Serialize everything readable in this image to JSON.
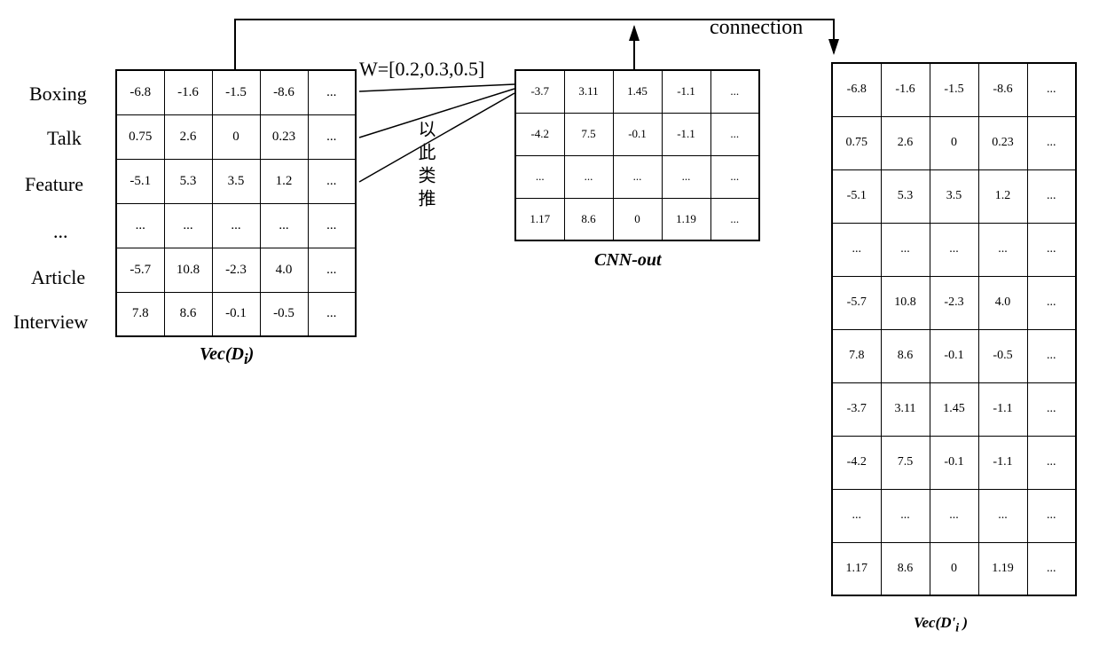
{
  "labels": {
    "row0": "Boxing",
    "row1": "Talk",
    "row2": "Feature",
    "row3": "...",
    "row4": "Article",
    "row5": "Interview",
    "connection": "connection",
    "weights": "W=[0.2,0.3,0.5]",
    "ycltp": "以此类推"
  },
  "captions": {
    "vecDi": "Vec(D_i)",
    "cnnOut": "CNN-out",
    "vecDiPrime": "Vec(D'_i )"
  },
  "chart_data": {
    "type": "table",
    "tables": [
      {
        "name": "Vec(D_i)",
        "row_labels": [
          "Boxing",
          "Talk",
          "Feature",
          "...",
          "Article",
          "Interview"
        ],
        "cells": [
          [
            "-6.8",
            "-1.6",
            "-1.5",
            "-8.6",
            "..."
          ],
          [
            "0.75",
            "2.6",
            "0",
            "0.23",
            "..."
          ],
          [
            "-5.1",
            "5.3",
            "3.5",
            "1.2",
            "..."
          ],
          [
            "...",
            "...",
            "...",
            "...",
            "..."
          ],
          [
            "-5.7",
            "10.8",
            "-2.3",
            "4.0",
            "..."
          ],
          [
            "7.8",
            "8.6",
            "-0.1",
            "-0.5",
            "..."
          ]
        ]
      },
      {
        "name": "CNN-out",
        "cells": [
          [
            "-3.7",
            "3.11",
            "1.45",
            "-1.1",
            "..."
          ],
          [
            "-4.2",
            "7.5",
            "-0.1",
            "-1.1",
            "..."
          ],
          [
            "...",
            "...",
            "...",
            "...",
            "..."
          ],
          [
            "1.17",
            "8.6",
            "0",
            "1.19",
            "..."
          ]
        ]
      },
      {
        "name": "Vec(D'_i)",
        "cells": [
          [
            "-6.8",
            "-1.6",
            "-1.5",
            "-8.6",
            "..."
          ],
          [
            "0.75",
            "2.6",
            "0",
            "0.23",
            "..."
          ],
          [
            "-5.1",
            "5.3",
            "3.5",
            "1.2",
            "..."
          ],
          [
            "...",
            "...",
            "...",
            "...",
            "..."
          ],
          [
            "-5.7",
            "10.8",
            "-2.3",
            "4.0",
            "..."
          ],
          [
            "7.8",
            "8.6",
            "-0.1",
            "-0.5",
            "..."
          ],
          [
            "-3.7",
            "3.11",
            "1.45",
            "-1.1",
            "..."
          ],
          [
            "-4.2",
            "7.5",
            "-0.1",
            "-1.1",
            "..."
          ],
          [
            "...",
            "...",
            "...",
            "...",
            "..."
          ],
          [
            "1.17",
            "8.6",
            "0",
            "1.19",
            "..."
          ]
        ]
      }
    ],
    "weights": [
      0.2,
      0.3,
      0.5
    ],
    "operation": "connection"
  }
}
